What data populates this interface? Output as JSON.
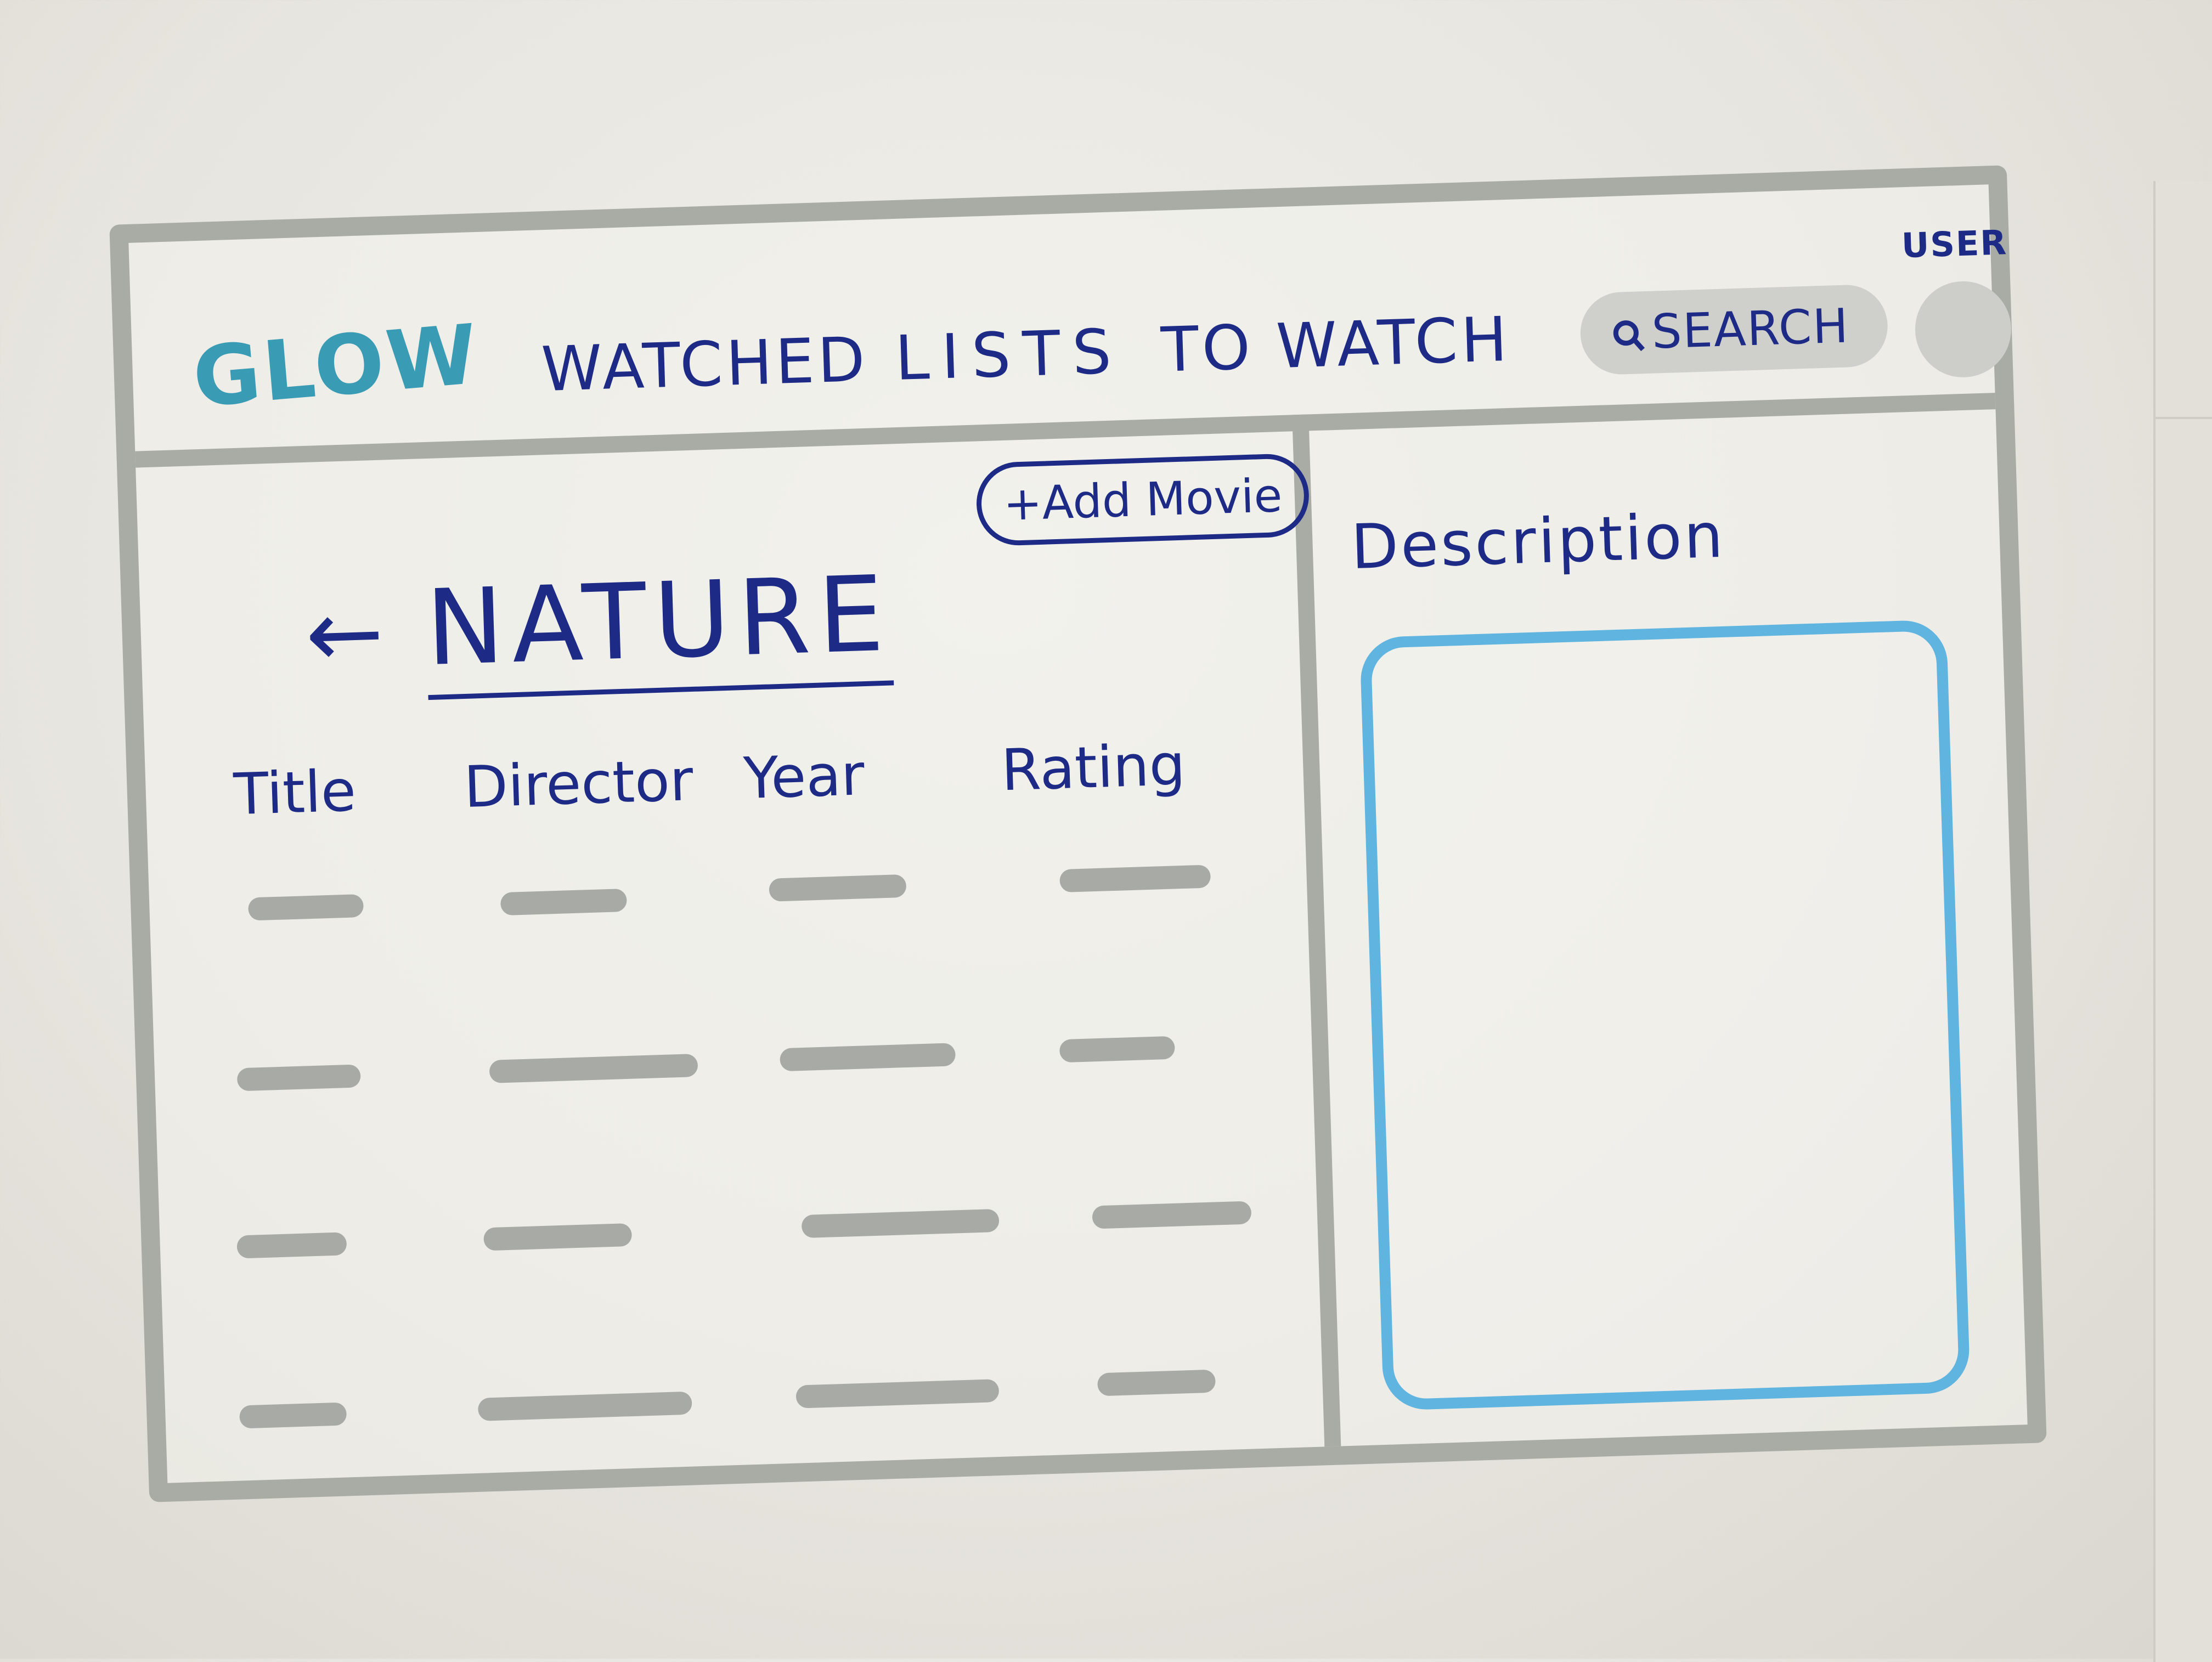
{
  "app": {
    "logo": "GLOW",
    "accent_color": "#3a9bb4",
    "ink_color": "#1d2b86",
    "frame_color": "#a9aba5"
  },
  "nav": {
    "watched": "WATCHED",
    "lists": "LISTS",
    "to_watch": "TO WATCH"
  },
  "search": {
    "label": "SEARCH",
    "icon": "search-icon"
  },
  "user": {
    "label": "USER",
    "icon": "avatar"
  },
  "list": {
    "title": "NATURE",
    "back_icon": "arrow-left-icon",
    "add_button": "+Add Movie",
    "columns": [
      "Title",
      "Director",
      "Year",
      "Rating"
    ],
    "row_count": 4
  },
  "description": {
    "label": "Description",
    "box_color": "#5fb4e0"
  }
}
